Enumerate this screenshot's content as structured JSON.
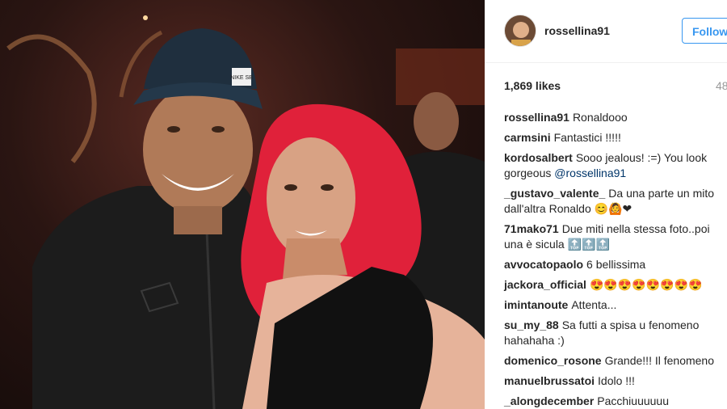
{
  "post": {
    "username": "rossellina91",
    "follow_label": "Follow",
    "likes": "1,869 likes",
    "age": "48"
  },
  "comments": [
    {
      "user": "rossellina91",
      "text": "Ronaldooo"
    },
    {
      "user": "carmsini",
      "text": "Fantastici !!!!!"
    },
    {
      "user": "kordosalbert",
      "text": "Sooo jealous! :=) You look gorgeous ",
      "mention": "@rossellina91"
    },
    {
      "user": "_gustavo_valente_",
      "text": "Da una parte un mito dall'altra Ronaldo 😊🙆❤"
    },
    {
      "user": "71mako71",
      "text": "Due miti nella stessa foto..poi una è sicula 🔝🔝🔝"
    },
    {
      "user": "avvocatopaolo",
      "text": "6 bellissima"
    },
    {
      "user": "jackora_official",
      "text": "😍😍😍😍😍😍😍😍"
    },
    {
      "user": "imintanoute",
      "text": "Attenta..."
    },
    {
      "user": "su_my_88",
      "text": "Sa futti a spisa u fenomeno hahahaha :)"
    },
    {
      "user": "domenico_rosone",
      "text": "Grande!!! Il fenomeno"
    },
    {
      "user": "manuelbrussatoi",
      "text": "Idolo !!!"
    },
    {
      "user": "_alongdecember",
      "text": "Pacchiuuuuuu"
    }
  ],
  "photo": {
    "cap_logo_text": "NIKE SB",
    "colors": {
      "hair": "#e0213a",
      "cap": "#1f2f3e",
      "jacket": "#1c1c1c",
      "dress": "#111111",
      "skin": "#c98c6a",
      "skin_light": "#e6b39a"
    }
  },
  "icons": {
    "avatar": "profile-avatar"
  }
}
